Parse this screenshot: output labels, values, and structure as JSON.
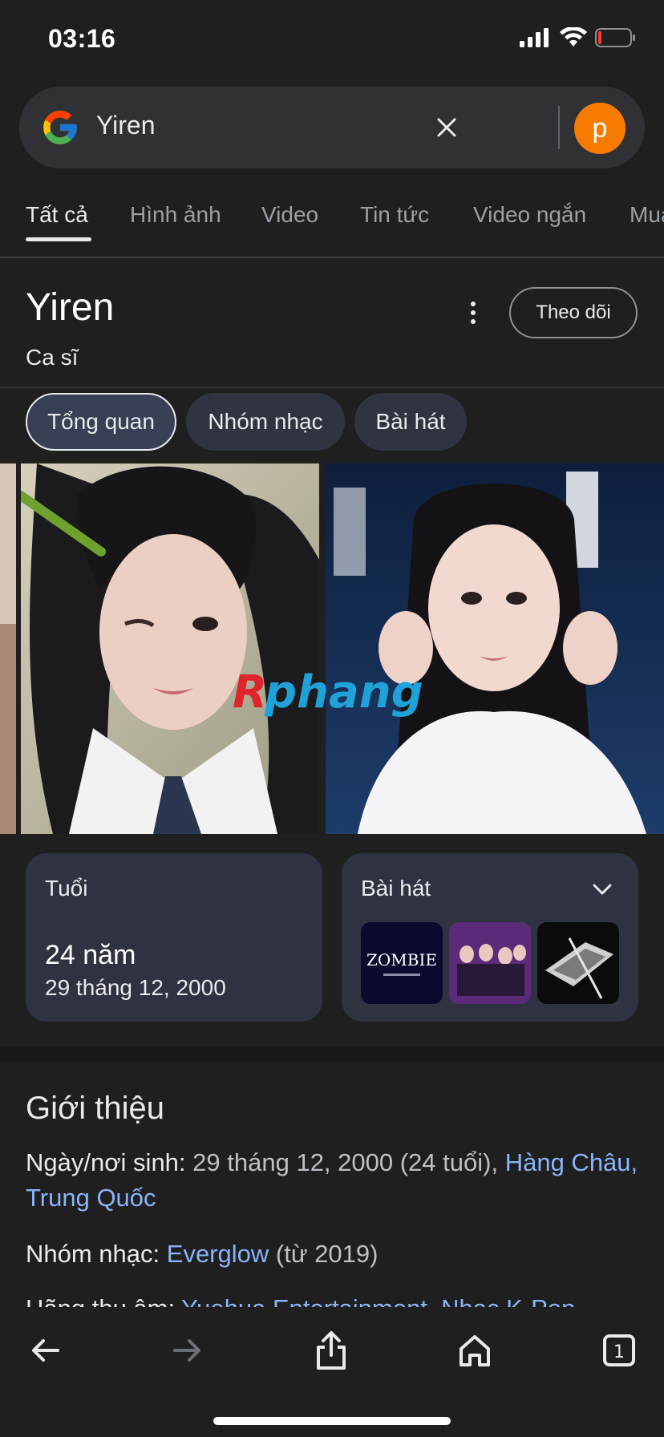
{
  "status_bar": {
    "time": "03:16"
  },
  "search": {
    "query": "Yiren",
    "avatar_letter": "p"
  },
  "tabs": [
    {
      "label": "Tất cả",
      "active": true
    },
    {
      "label": "Hình ảnh"
    },
    {
      "label": "Video"
    },
    {
      "label": "Tin tức"
    },
    {
      "label": "Video ngắn"
    },
    {
      "label": "Mua sắm"
    }
  ],
  "entity": {
    "title": "Yiren",
    "subtitle": "Ca sĩ",
    "follow_label": "Theo dõi"
  },
  "chips": [
    {
      "label": "Tổng quan",
      "active": true
    },
    {
      "label": "Nhóm nhạc"
    },
    {
      "label": "Bài hát"
    }
  ],
  "images": {
    "watermark": "Rphang"
  },
  "cards": {
    "age": {
      "title": "Tuổi",
      "value": "24 năm",
      "birth": "29 tháng 12, 2000"
    },
    "songs": {
      "title": "Bài hát",
      "thumb1_text": "ZOMBIE"
    }
  },
  "about": {
    "title": "Giới thiệu",
    "birth_label": "Ngày/nơi sinh:",
    "birth_value": "29 tháng 12, 2000 (24 tuổi),",
    "birth_place": "Hàng Châu, Trung Quốc",
    "group_label": "Nhóm nhạc:",
    "group_value": "Everglow",
    "group_since": "(từ 2019)",
    "label_label": "Hãng thu âm:",
    "label_value": "Yuehua Entertainment, Nhạc K-Pop"
  },
  "toolbar": {
    "tab_count": "1"
  },
  "colors": {
    "background": "#1f1f1f",
    "link": "#8ab4f8",
    "avatar": "#f57c00",
    "card": "#2f3240"
  }
}
